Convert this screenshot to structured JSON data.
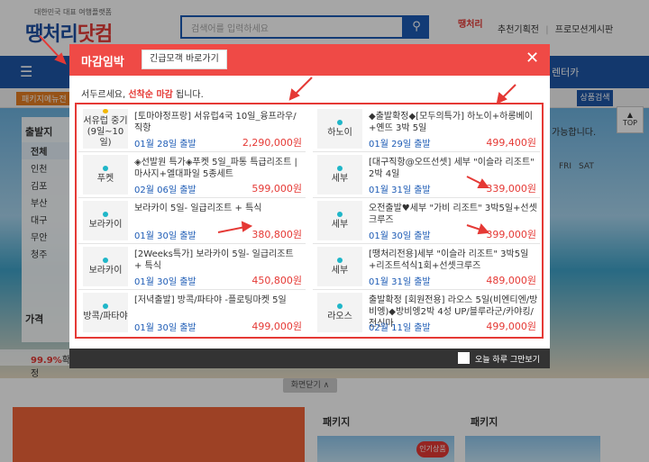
{
  "header": {
    "tagline": "대한민국 대표 여행플랫폼",
    "logo_a": "땡처리",
    "logo_b": "닷컴",
    "search_placeholder": "검색어를 입력하세요",
    "search_icon": "search-icon",
    "mini_logo": "땡처리",
    "links": [
      "추천기획전",
      "프로모션게시판"
    ]
  },
  "nav": {
    "menu_icon": "☰",
    "right_items": [
      "렌터카"
    ]
  },
  "subbar": {
    "left_label": "패키지메뉴전",
    "right_label": "상품검색"
  },
  "sidebar": {
    "heading": "출발지",
    "items": [
      "전체",
      "인천",
      "김포",
      "부산",
      "대구",
      "무안",
      "청주"
    ],
    "price_label": "가격",
    "confirm_rate": "99.9%",
    "confirm_suffix": "확정"
  },
  "right_widget": {
    "info": "가능합니다.",
    "fri": "FRI",
    "sat": "SAT"
  },
  "top_button": {
    "icon": "▲",
    "label": "TOP"
  },
  "menu_close": "화면닫기 ∧",
  "bottom": {
    "pkg_label_1": "패키지",
    "pkg_label_2": "패키지",
    "hot_badge": "인기상품"
  },
  "modal": {
    "title": "마감임박",
    "urgent_button": "긴급모객 바로가기",
    "close_icon": "✕",
    "notice_prefix": "서두르세요, ",
    "notice_highlight": "선착순 마감",
    "notice_suffix": " 됩니다.",
    "footer_label": "오늘 하루 그만보기",
    "accent_color": "#ef4a46",
    "left_deals": [
      {
        "city": "서유럽 중기(9일~10일)",
        "dot": "gold",
        "title": "[토마야정프랑] 서유럽4국 10일_융프라우/직항",
        "date": "01월 28일 출발",
        "price": "2,290,000원"
      },
      {
        "city": "푸켓",
        "dot": "teal",
        "title": "◈선발원 특가◈푸켓 5일_파통 특급리조트 | 마사지+엘대파일 5종세트",
        "date": "02월 06일 출발",
        "price": "599,000원"
      },
      {
        "city": "보라카이",
        "dot": "teal",
        "title": "보라카이 5일- 일급리조트 + 특식",
        "date": "01월 30일 출발",
        "price": "380,800원"
      },
      {
        "city": "보라카이",
        "dot": "teal",
        "title": "[2Weeks특가] 보라카이 5일- 일급리조트 + 특식",
        "date": "01월 30일 출발",
        "price": "450,800원"
      },
      {
        "city": "방콕/파타야",
        "dot": "teal",
        "title": "[저녁출발] 방콕/파타야 -플로팅마켓 5일",
        "date": "01월 30일 출발",
        "price": "499,000원"
      }
    ],
    "right_deals": [
      {
        "city": "하노이",
        "dot": "teal",
        "title": "◆출발확정◆[모두의특가] 하노이+하롱베이+옌뜨 3박 5일",
        "date": "01월 29일 출발",
        "price": "499,400원"
      },
      {
        "city": "세부",
        "dot": "teal",
        "title": "[대구직항@오뜨선셋] 세부 \"이슬라 리조트\" 2박 4일",
        "date": "01월 31일 출발",
        "price": "339,000원"
      },
      {
        "city": "세부",
        "dot": "teal",
        "title": "오전출발♥세부 \"가비 리조트\" 3박5일+선셋크루즈",
        "date": "01월 30일 출발",
        "price": "399,000원"
      },
      {
        "city": "세부",
        "dot": "teal",
        "title": "[땡처리전용]세부 \"이슬라 리조트\" 3박5일+리조트석식1회+선셋크루즈",
        "date": "01월 31일 출발",
        "price": "489,000원"
      },
      {
        "city": "라오스",
        "dot": "teal",
        "title": "출발확정 [회원전용] 라오스 5일(비엔티엔/방비엥)◆방비엥2박 4성 UP/블루라군/카야킹/전신마",
        "date": "02월 11일 출발",
        "price": "499,000원"
      }
    ]
  }
}
